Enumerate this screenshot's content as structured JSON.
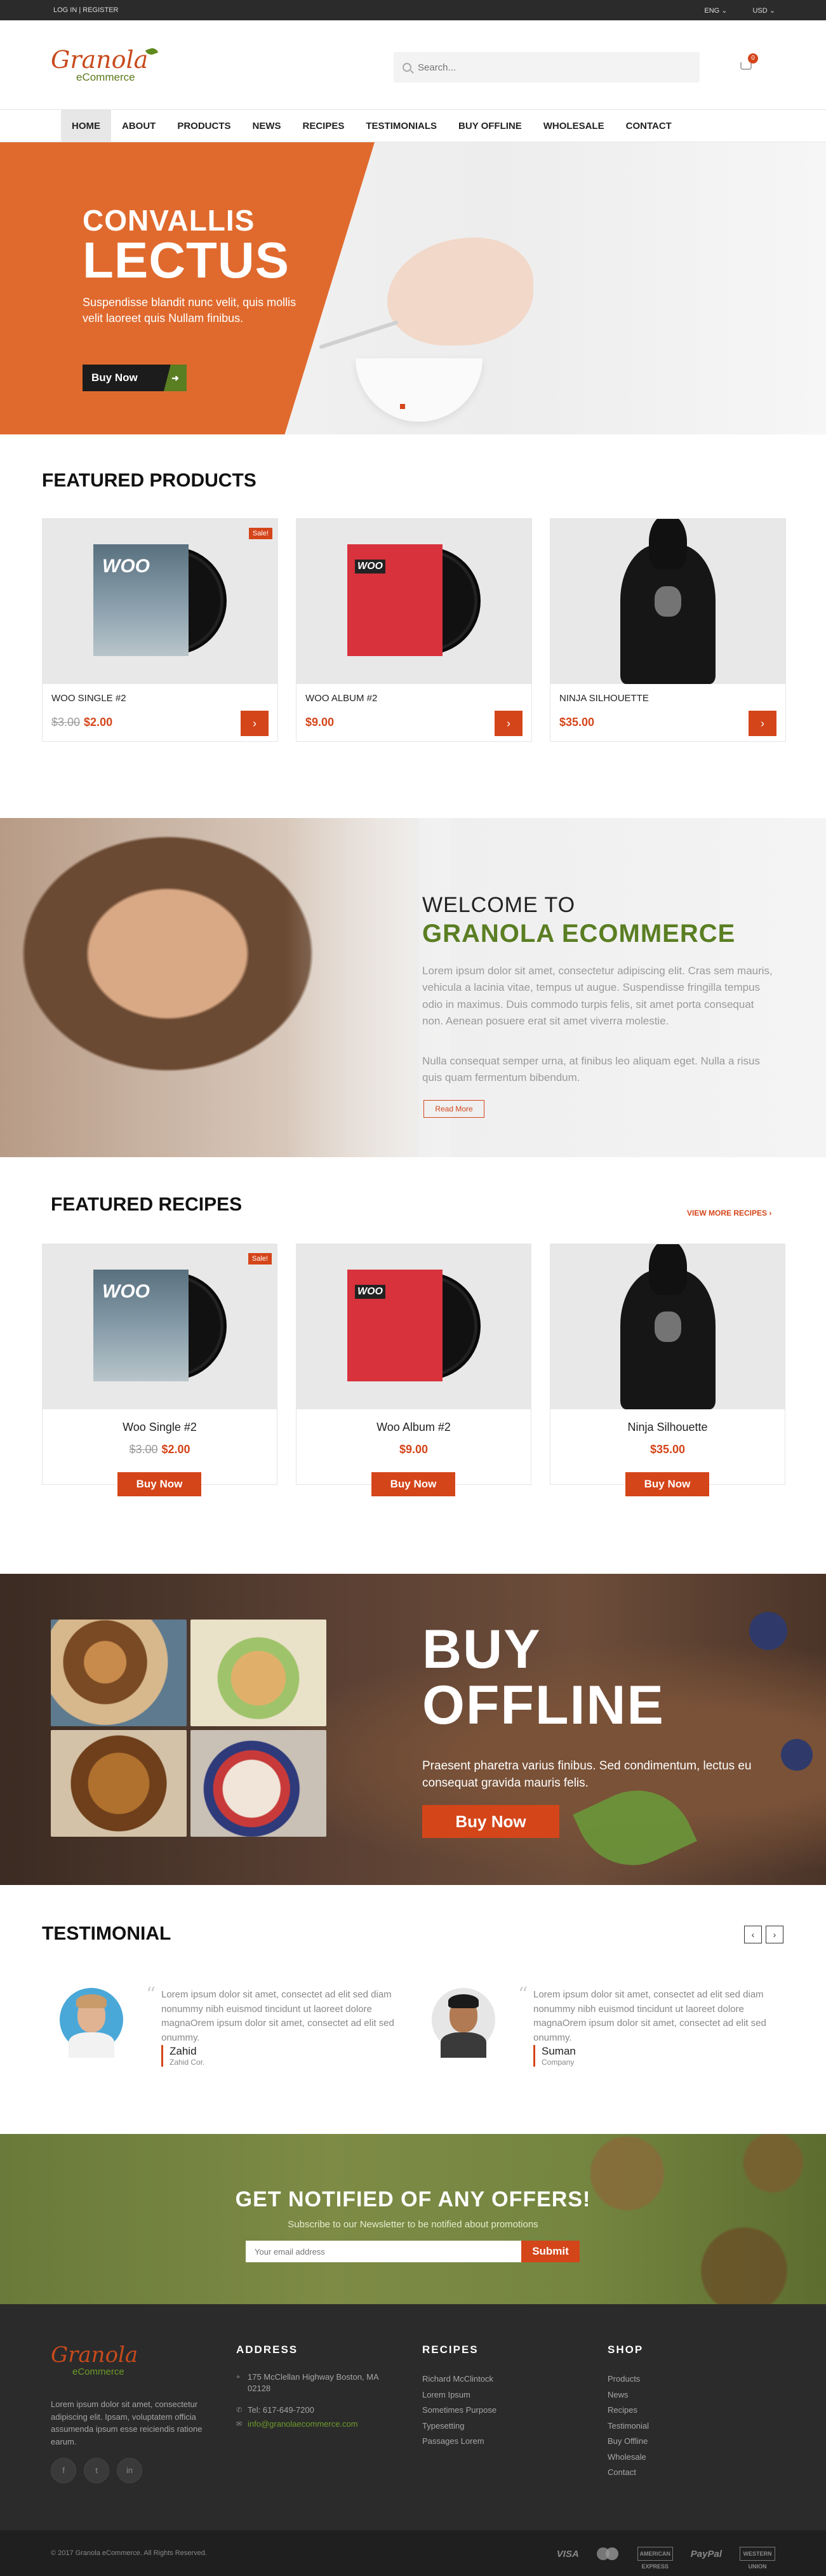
{
  "topbar": {
    "account": "LOG IN | REGISTER",
    "lang": "ENG",
    "currency": "USD"
  },
  "header": {
    "logo_script": "Granola",
    "logo_sub": "eCommerce",
    "search_placeholder": "Search...",
    "cart_count": "0"
  },
  "nav": [
    "HOME",
    "ABOUT",
    "PRODUCTS",
    "NEWS",
    "RECIPES",
    "TESTIMONIALS",
    "BUY OFFLINE",
    "WHOLESALE",
    "CONTACT"
  ],
  "hero": {
    "title_small": "CONVALLIS",
    "title_big": "LECTUS",
    "lead": "Suspendisse blandit nunc velit, quis mollis velit laoreet quis Nullam finibus.",
    "button": "Buy Now"
  },
  "featured_products": {
    "title": "FEATURED PRODUCTS",
    "items": [
      {
        "name": "WOO SINGLE #2",
        "old_price": "$3.00",
        "price": "$2.00",
        "sale": "Sale!",
        "art": "vinyl-blue",
        "art_label": "WOO"
      },
      {
        "name": "WOO ALBUM #2",
        "old_price": "",
        "price": "$9.00",
        "sale": "",
        "art": "vinyl-red",
        "art_label": "WOO"
      },
      {
        "name": "NINJA SILHOUETTE",
        "old_price": "",
        "price": "$35.00",
        "sale": "",
        "art": "hoodie",
        "art_label": ""
      }
    ]
  },
  "welcome": {
    "line1": "WELCOME TO",
    "line2": "GRANOLA ECOMMERCE",
    "para1": "Lorem ipsum dolor sit amet, consectetur adipiscing elit. Cras sem mauris, vehicula a lacinia vitae, tempus ut augue. Suspendisse fringilla tempus odio in maximus. Duis commodo turpis felis, sit amet porta consequat non. Aenean posuere erat sit amet viverra molestie.",
    "para2": "Nulla consequat semper urna, at finibus leo aliquam eget. Nulla a risus quis quam fermentum bibendum.",
    "button": "Read More"
  },
  "featured_recipes": {
    "title": "FEATURED RECIPES",
    "view_more": "VIEW MORE RECIPES ›",
    "items": [
      {
        "name": "Woo Single #2",
        "old_price": "$3.00",
        "price": "$2.00",
        "sale": "Sale!",
        "button": "Buy Now",
        "art": "vinyl-blue"
      },
      {
        "name": "Woo Album #2",
        "old_price": "",
        "price": "$9.00",
        "sale": "",
        "button": "Buy Now",
        "art": "vinyl-red"
      },
      {
        "name": "Ninja Silhouette",
        "old_price": "",
        "price": "$35.00",
        "sale": "",
        "button": "Buy Now",
        "art": "hoodie"
      }
    ]
  },
  "buy_offline": {
    "line1": "BUY",
    "line2": "OFFLINE",
    "lead": "Praesent pharetra varius finibus. Sed condimentum, lectus eu consequat gravida mauris felis.",
    "button": "Buy Now"
  },
  "testimonial": {
    "title": "TESTIMONIAL",
    "prev": "‹",
    "next": "›",
    "items": [
      {
        "text": "Lorem ipsum dolor sit amet, consectet ad elit sed diam nonummy nibh euismod tincidunt ut laoreet dolore magnaOrem ipsum dolor sit amet, consectet ad elit sed onummy.",
        "name": "Zahid",
        "company": "Zahid Cor."
      },
      {
        "text": "Lorem ipsum dolor sit amet, consectet ad elit sed diam nonummy nibh euismod tincidunt ut laoreet dolore magnaOrem ipsum dolor sit amet, consectet ad elit sed onummy.",
        "name": "Suman",
        "company": "Company"
      }
    ]
  },
  "newsletter": {
    "title": "GET NOTIFIED OF ANY OFFERS!",
    "subtitle": "Subscribe to our Newsletter to be notified about promotions",
    "placeholder": "Your email address",
    "button": "Submit"
  },
  "footer": {
    "logo_script": "Granola",
    "logo_sub": "eCommerce",
    "about": "Lorem ipsum dolor sit amet, consectetur adipiscing elit. Ipsam, voluptatem officia assumenda ipsum esse reiciendis ratione earum.",
    "socials": [
      "f",
      "t",
      "in"
    ],
    "address": {
      "title": "ADDRESS",
      "street": "175 McClellan Highway Boston, MA 02128",
      "phone": "Tel: 617-649-7200",
      "email": "info@granolaecommerce.com"
    },
    "recipes": {
      "title": "RECIPES",
      "items": [
        "Richard McClintock",
        "Lorem Ipsum",
        "Sometimes Purpose",
        "Typesetting",
        "Passages Lorem"
      ]
    },
    "shop": {
      "title": "SHOP",
      "items": [
        "Products",
        "News",
        "Recipes",
        "Testimonial",
        "Buy Offline",
        "Wholesale",
        "Contact"
      ]
    },
    "copyright": "© 2017 Granola eCommerce. All Rights Reserved.",
    "payments": [
      "VISA",
      "MasterCard",
      "AMERICAN EXPRESS",
      "PayPal",
      "WESTERN UNION"
    ]
  },
  "colors": {
    "accent": "#d4451a",
    "brand_green": "#5a7e22",
    "hero_orange": "#e06a2e",
    "dark": "#2b2b2b"
  }
}
